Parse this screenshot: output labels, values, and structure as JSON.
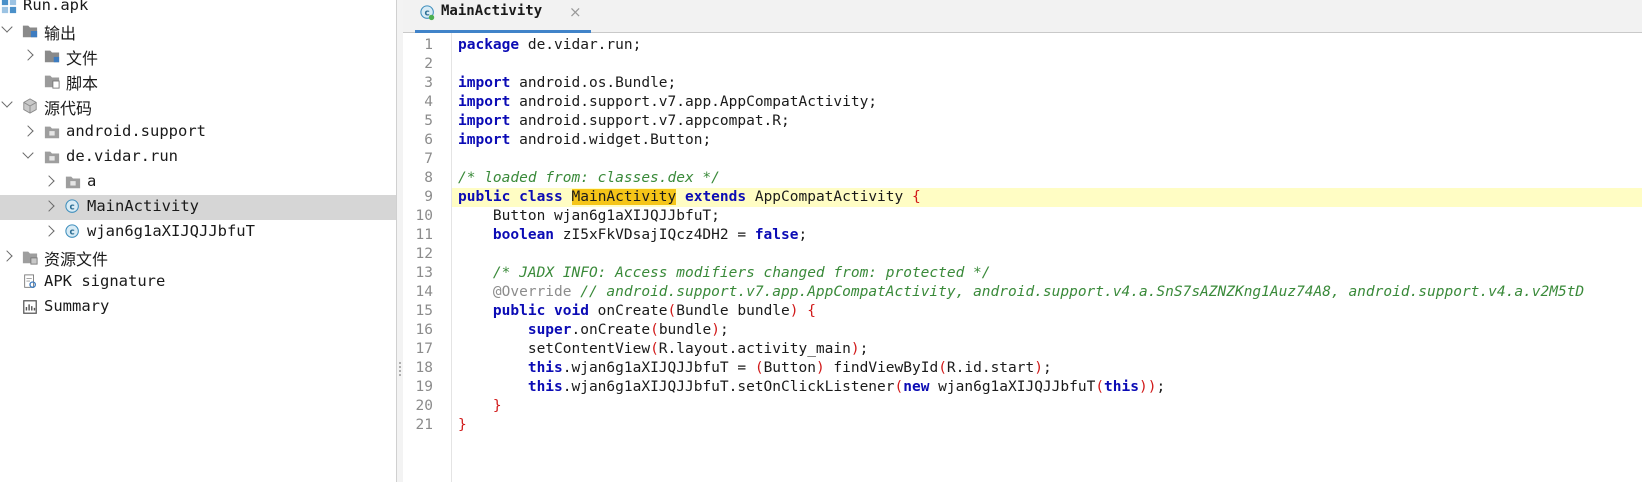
{
  "tree": {
    "items": [
      {
        "label": "Run.apk",
        "icon": "apk-icon",
        "level": 0,
        "arrow": "none"
      },
      {
        "label": "输出",
        "icon": "output-folder-icon",
        "level": 0,
        "arrow": "down"
      },
      {
        "label": "文件",
        "icon": "folder-icon",
        "level": 1,
        "arrow": "right"
      },
      {
        "label": "脚本",
        "icon": "script-folder-icon",
        "level": 1,
        "arrow": "none"
      },
      {
        "label": "源代码",
        "icon": "package-icon",
        "level": 0,
        "arrow": "down"
      },
      {
        "label": "android.support",
        "icon": "package-folder-icon",
        "level": 1,
        "arrow": "right"
      },
      {
        "label": "de.vidar.run",
        "icon": "package-folder-icon",
        "level": 1,
        "arrow": "down"
      },
      {
        "label": "a",
        "icon": "package-folder-icon",
        "level": 2,
        "arrow": "right"
      },
      {
        "label": "MainActivity",
        "icon": "class-icon",
        "level": 2,
        "arrow": "right",
        "selected": true
      },
      {
        "label": "wjan6g1aXIJQJJbfuT",
        "icon": "class-icon",
        "level": 2,
        "arrow": "right"
      },
      {
        "label": "资源文件",
        "icon": "resources-folder-icon",
        "level": 0,
        "arrow": "right"
      },
      {
        "label": "APK signature",
        "icon": "signature-icon",
        "level": 0,
        "arrow": "none"
      },
      {
        "label": "Summary",
        "icon": "summary-icon",
        "level": 0,
        "arrow": "none"
      }
    ]
  },
  "editor": {
    "tab": {
      "label": "MainActivity",
      "close": "×"
    },
    "lines": [
      [
        [
          "kw",
          "package"
        ],
        [
          "t",
          " de.vidar.run;"
        ]
      ],
      [],
      [
        [
          "kw",
          "import"
        ],
        [
          "t",
          " android.os.Bundle;"
        ]
      ],
      [
        [
          "kw",
          "import"
        ],
        [
          "t",
          " android.support.v7.app.AppCompatActivity;"
        ]
      ],
      [
        [
          "kw",
          "import"
        ],
        [
          "t",
          " android.support.v7.appcompat.R;"
        ]
      ],
      [
        [
          "kw",
          "import"
        ],
        [
          "t",
          " android.widget.Button;"
        ]
      ],
      [],
      [
        [
          "cm",
          "/* loaded from: classes.dex */"
        ]
      ],
      [
        [
          "kw",
          "public class "
        ],
        [
          "mark",
          "MainActivity"
        ],
        [
          "kw",
          " extends "
        ],
        [
          "t",
          "AppCompatActivity "
        ],
        [
          "pr",
          "{"
        ]
      ],
      [
        [
          "t",
          "    Button wjan6g1aXIJQJJbfuT;"
        ]
      ],
      [
        [
          "t",
          "    "
        ],
        [
          "kw",
          "boolean"
        ],
        [
          "t",
          " zI5xFkVDsajIQcz4DH2 = "
        ],
        [
          "kw",
          "false"
        ],
        [
          "t",
          ";"
        ]
      ],
      [],
      [
        [
          "t",
          "    "
        ],
        [
          "cm",
          "/* JADX INFO: Access modifiers changed from: protected */"
        ]
      ],
      [
        [
          "t",
          "    "
        ],
        [
          "an",
          "@Override"
        ],
        [
          "t",
          " "
        ],
        [
          "cm",
          "// android.support.v7.app.AppCompatActivity, android.support.v4.a.SnS7sAZNZKng1Auz74A8, android.support.v4.a.v2M5tD"
        ]
      ],
      [
        [
          "t",
          "    "
        ],
        [
          "kw",
          "public void"
        ],
        [
          "t",
          " onCreate"
        ],
        [
          "pr",
          "("
        ],
        [
          "t",
          "Bundle bundle"
        ],
        [
          "pr",
          ")"
        ],
        [
          "t",
          " "
        ],
        [
          "pr",
          "{"
        ]
      ],
      [
        [
          "t",
          "        "
        ],
        [
          "kw",
          "super"
        ],
        [
          "t",
          ".onCreate"
        ],
        [
          "pr",
          "("
        ],
        [
          "t",
          "bundle"
        ],
        [
          "pr",
          ")"
        ],
        [
          "t",
          ";"
        ]
      ],
      [
        [
          "t",
          "        setContentView"
        ],
        [
          "pr",
          "("
        ],
        [
          "t",
          "R.layout.activity_main"
        ],
        [
          "pr",
          ")"
        ],
        [
          "t",
          ";"
        ]
      ],
      [
        [
          "t",
          "        "
        ],
        [
          "kw",
          "this"
        ],
        [
          "t",
          ".wjan6g1aXIJQJJbfuT = "
        ],
        [
          "pr",
          "("
        ],
        [
          "t",
          "Button"
        ],
        [
          "pr",
          ")"
        ],
        [
          "t",
          " findViewById"
        ],
        [
          "pr",
          "("
        ],
        [
          "t",
          "R.id.start"
        ],
        [
          "pr",
          ")"
        ],
        [
          "t",
          ";"
        ]
      ],
      [
        [
          "t",
          "        "
        ],
        [
          "kw",
          "this"
        ],
        [
          "t",
          ".wjan6g1aXIJQJJbfuT.setOnClickListener"
        ],
        [
          "pr",
          "("
        ],
        [
          "kw",
          "new"
        ],
        [
          "t",
          " wjan6g1aXIJQJJbfuT"
        ],
        [
          "pr",
          "("
        ],
        [
          "kw",
          "this"
        ],
        [
          "pr",
          "))"
        ],
        [
          "t",
          ";"
        ]
      ],
      [
        [
          "t",
          "    "
        ],
        [
          "pr",
          "}"
        ]
      ],
      [
        [
          "pr",
          "}"
        ]
      ]
    ],
    "highlighted_line": 9,
    "colors": {
      "keyword": "#0b0bb5",
      "comment": "#3a8a3a",
      "annotation": "#8c8c8c",
      "paren": "#d11a1a",
      "highlight": "#fffdc4",
      "match": "#f5c518",
      "tab_underline": "#4083c9"
    }
  }
}
